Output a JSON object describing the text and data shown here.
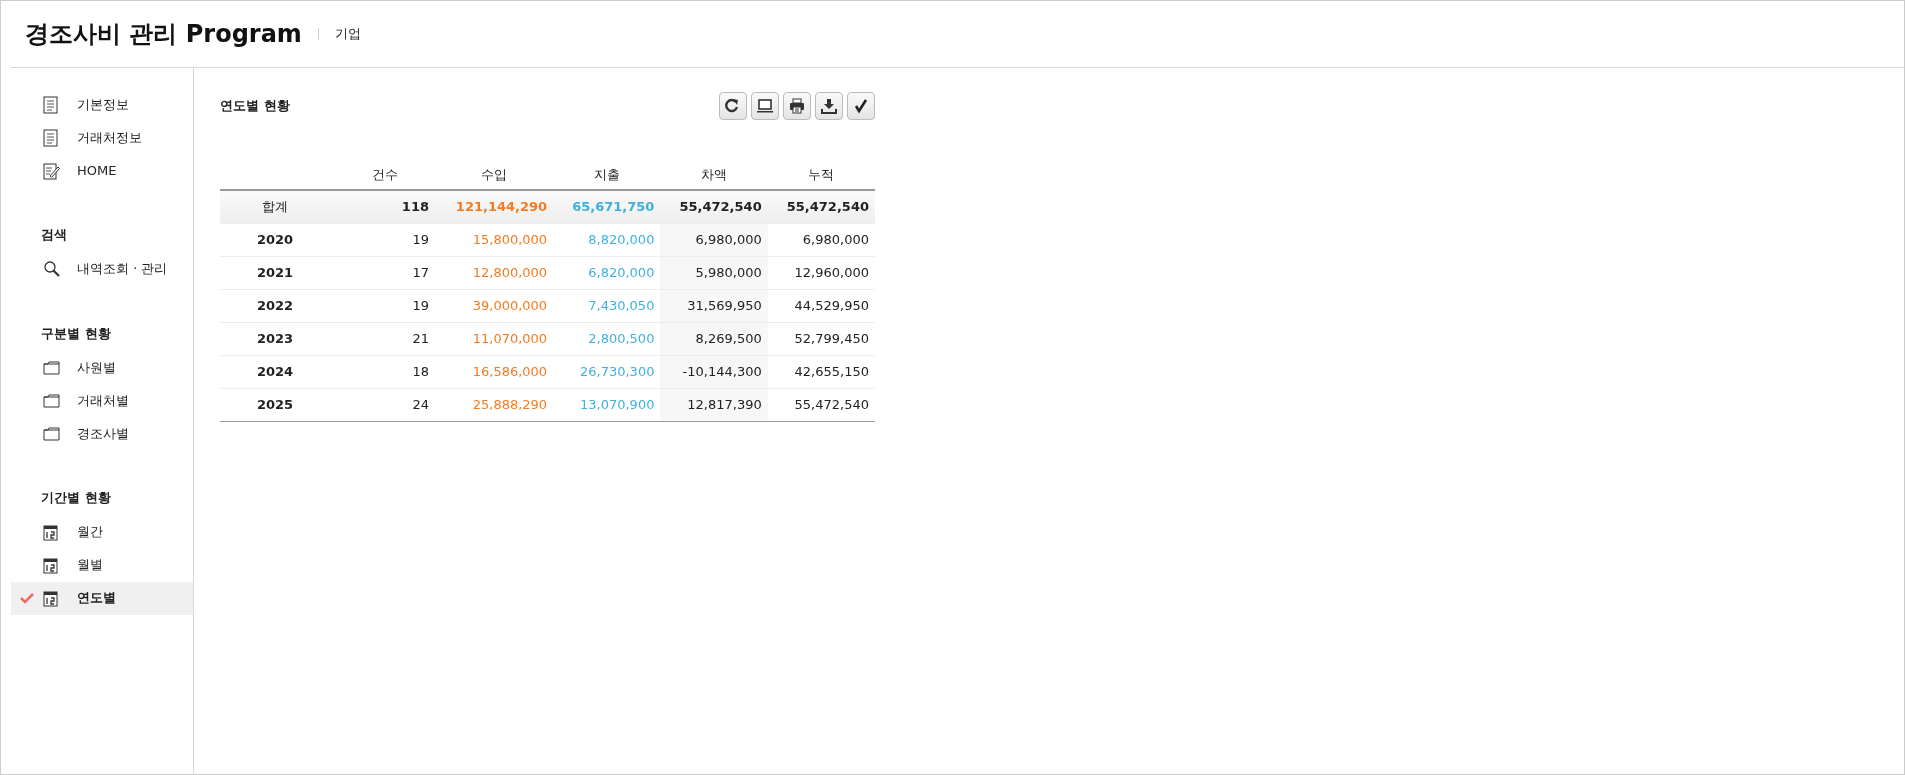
{
  "header": {
    "title": "경조사비 관리 Program",
    "subtitle": "기업"
  },
  "sidebar": {
    "sections": [
      {
        "items": [
          {
            "label": "기본정보",
            "kind": "document",
            "selected": false
          },
          {
            "label": "거래처정보",
            "kind": "document",
            "selected": false
          },
          {
            "label": "HOME",
            "kind": "edit",
            "selected": false
          }
        ]
      },
      {
        "heading": "검색",
        "items": [
          {
            "label": "내역조회 · 관리",
            "kind": "search",
            "selected": false
          }
        ]
      },
      {
        "heading": "구분별 현황",
        "items": [
          {
            "label": "사원별",
            "kind": "folder",
            "selected": false
          },
          {
            "label": "거래처별",
            "kind": "folder",
            "selected": false
          },
          {
            "label": "경조사별",
            "kind": "folder",
            "selected": false
          }
        ]
      },
      {
        "heading": "기간별 현황",
        "items": [
          {
            "label": "월간",
            "kind": "calendar",
            "selected": false
          },
          {
            "label": "월별",
            "kind": "calendar",
            "selected": false
          },
          {
            "label": "연도별",
            "kind": "calendar",
            "selected": true
          }
        ]
      }
    ]
  },
  "main": {
    "title": "연도별 현황",
    "toolbar": [
      {
        "kind": "refresh"
      },
      {
        "kind": "laptop"
      },
      {
        "kind": "print"
      },
      {
        "kind": "download"
      },
      {
        "kind": "check"
      }
    ],
    "table": {
      "columns": [
        "건수",
        "수입",
        "지출",
        "차액",
        "누적"
      ],
      "rows": [
        {
          "kind": "total",
          "label": "합계",
          "count": "118",
          "income": "121,144,290",
          "expense": "65,671,750",
          "balance": "55,472,540",
          "cumulative": "55,472,540"
        },
        {
          "kind": "year",
          "label": "2020",
          "count": "19",
          "income": "15,800,000",
          "expense": "8,820,000",
          "balance": "6,980,000",
          "cumulative": "6,980,000"
        },
        {
          "kind": "year",
          "label": "2021",
          "count": "17",
          "income": "12,800,000",
          "expense": "6,820,000",
          "balance": "5,980,000",
          "cumulative": "12,960,000"
        },
        {
          "kind": "year",
          "label": "2022",
          "count": "19",
          "income": "39,000,000",
          "expense": "7,430,050",
          "balance": "31,569,950",
          "cumulative": "44,529,950"
        },
        {
          "kind": "year",
          "label": "2023",
          "count": "21",
          "income": "11,070,000",
          "expense": "2,800,500",
          "balance": "8,269,500",
          "cumulative": "52,799,450"
        },
        {
          "kind": "year",
          "label": "2024",
          "count": "18",
          "income": "16,586,000",
          "expense": "26,730,300",
          "balance": "-10,144,300",
          "cumulative": "42,655,150"
        },
        {
          "kind": "year",
          "label": "2025",
          "count": "24",
          "income": "25,888,290",
          "expense": "13,070,900",
          "balance": "12,817,390",
          "cumulative": "55,472,540"
        }
      ]
    }
  }
}
